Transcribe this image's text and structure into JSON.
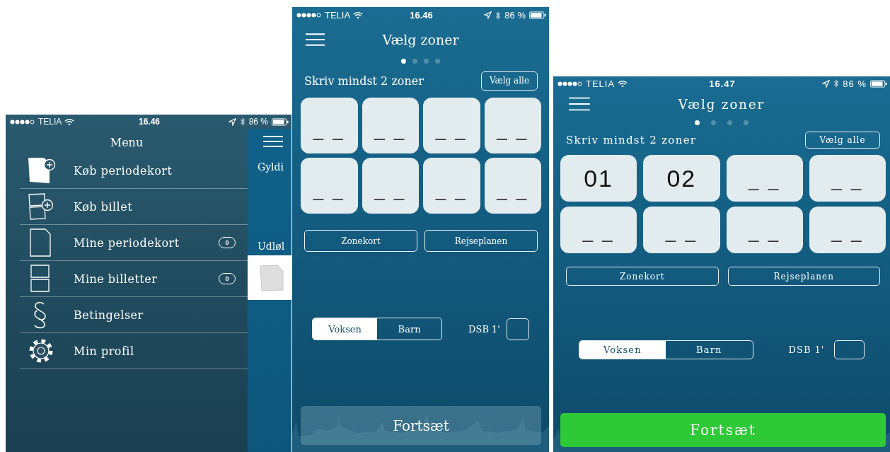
{
  "screens": [
    {
      "kind": "menu",
      "status_bar": {
        "carrier": "TELIA",
        "time": "16.46",
        "battery": "86 %"
      },
      "title": "Menu",
      "items": [
        {
          "label": "Køb periodekort"
        },
        {
          "label": "Køb billet"
        },
        {
          "label": "Mine periodekort",
          "badge": "0"
        },
        {
          "label": "Mine billetter",
          "badge": "0"
        },
        {
          "label": "Betingelser"
        },
        {
          "label": "Min profil"
        }
      ],
      "behind": {
        "texts": [
          "Gyldi",
          "Udløl"
        ]
      }
    },
    {
      "kind": "zones",
      "status_bar": {
        "carrier": "TELIA",
        "time": "16.46",
        "battery": "86 %"
      },
      "title": "Vælg zoner",
      "pages": [
        {
          "selected": true
        },
        {
          "selected": false
        },
        {
          "selected": false
        },
        {
          "selected": false
        }
      ],
      "instruction": "Skriv mindst 2 zoner",
      "select_all": "Vælg alle",
      "zones": [
        {
          "placeholder": "_ _"
        },
        {
          "placeholder": "_ _"
        },
        {
          "placeholder": "_ _"
        },
        {
          "placeholder": "_ _"
        },
        {
          "placeholder": "_ _"
        },
        {
          "placeholder": "_ _"
        },
        {
          "placeholder": "_ _"
        },
        {
          "placeholder": "_ _"
        }
      ],
      "links": [
        "Zonekort",
        "Rejseplanen"
      ],
      "passenger": [
        {
          "label": "Voksen",
          "selected": true
        },
        {
          "label": "Barn",
          "selected": false
        }
      ],
      "first_class": {
        "label": "DSB 1'",
        "checked": false
      },
      "continue": {
        "label": "Fortsæt",
        "disabled": true
      }
    },
    {
      "kind": "zones",
      "status_bar": {
        "carrier": "TELIA",
        "time": "16.47",
        "battery": "86 %"
      },
      "title": "Vælg zoner",
      "pages": [
        {
          "selected": true
        },
        {
          "selected": false
        },
        {
          "selected": false
        },
        {
          "selected": false
        }
      ],
      "instruction": "Skriv mindst 2 zoner",
      "select_all": "Vælg alle",
      "zones": [
        {
          "value": "01"
        },
        {
          "value": "02"
        },
        {
          "placeholder": "_ _"
        },
        {
          "placeholder": "_ _"
        },
        {
          "placeholder": "_ _"
        },
        {
          "placeholder": "_ _"
        },
        {
          "placeholder": "_ _"
        },
        {
          "placeholder": "_ _"
        }
      ],
      "links": [
        "Zonekort",
        "Rejseplanen"
      ],
      "passenger": [
        {
          "label": "Voksen",
          "selected": true
        },
        {
          "label": "Barn",
          "selected": false
        }
      ],
      "first_class": {
        "label": "DSB 1'",
        "checked": false
      },
      "continue": {
        "label": "Fortsæt",
        "disabled": false
      }
    }
  ]
}
